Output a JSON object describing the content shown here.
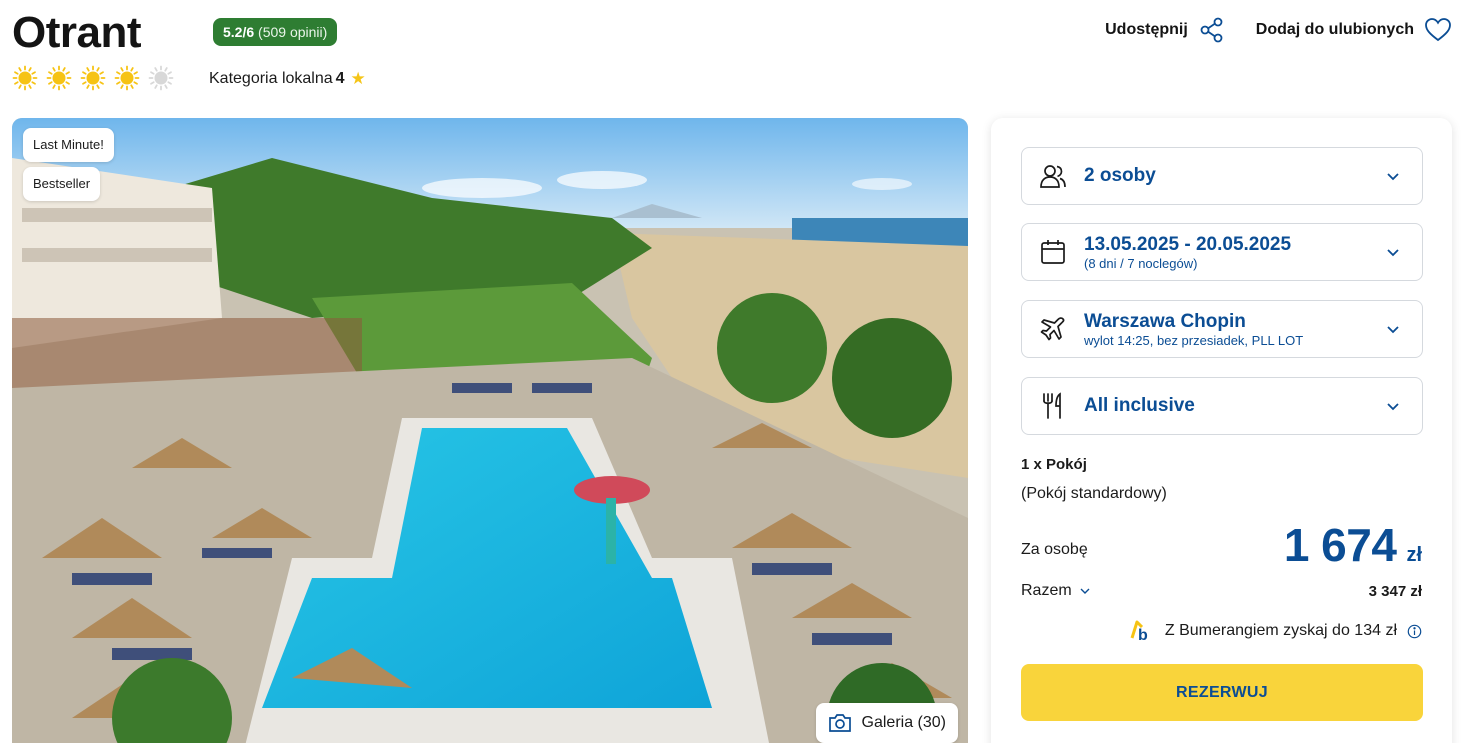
{
  "hotel": {
    "name": "Otrant",
    "rating": {
      "score": "5.2/6",
      "reviews": "(509 opinii)",
      "color": "#2e7d32"
    },
    "suns": {
      "filled": 4,
      "total": 5,
      "icon": "sun-icon"
    },
    "category": {
      "label": "Kategoria lokalna",
      "value": "4",
      "icon": "star-icon"
    }
  },
  "header_actions": {
    "share": {
      "label": "Udostępnij",
      "icon": "share-icon"
    },
    "favorite": {
      "label": "Dodaj do ulubionych",
      "icon": "heart-icon"
    }
  },
  "photo": {
    "badges": [
      "Last Minute!",
      "Bestseller"
    ],
    "gallery_label": "Galeria (30)",
    "gallery_icon": "camera-icon"
  },
  "booking": {
    "persons": {
      "value": "2 osoby",
      "icon": "people-icon"
    },
    "dates": {
      "value": "13.05.2025 - 20.05.2025",
      "sub": "(8 dni / 7 noclegów)",
      "icon": "calendar-icon"
    },
    "departure": {
      "value": "Warszawa Chopin",
      "sub": "wylot 14:25, bez przesiadek, PLL LOT",
      "icon": "plane-icon"
    },
    "board": {
      "value": "All inclusive",
      "icon": "cutlery-icon"
    },
    "room": {
      "count": "1 x Pokój",
      "type": "(Pokój standardowy)"
    },
    "price_per_person": {
      "label": "Za osobę",
      "value": "1 674",
      "currency": "zł"
    },
    "total": {
      "label": "Razem",
      "value": "3 347 zł"
    },
    "bumerang": {
      "text": "Z Bumerangiem zyskaj do 134 zł",
      "icon": "bumerang-logo-icon"
    },
    "cta": "REZERWUJ"
  },
  "colors": {
    "brand_blue": "#0b4d94",
    "cta_yellow": "#f9d43b",
    "sun_yellow": "#f6c314"
  }
}
